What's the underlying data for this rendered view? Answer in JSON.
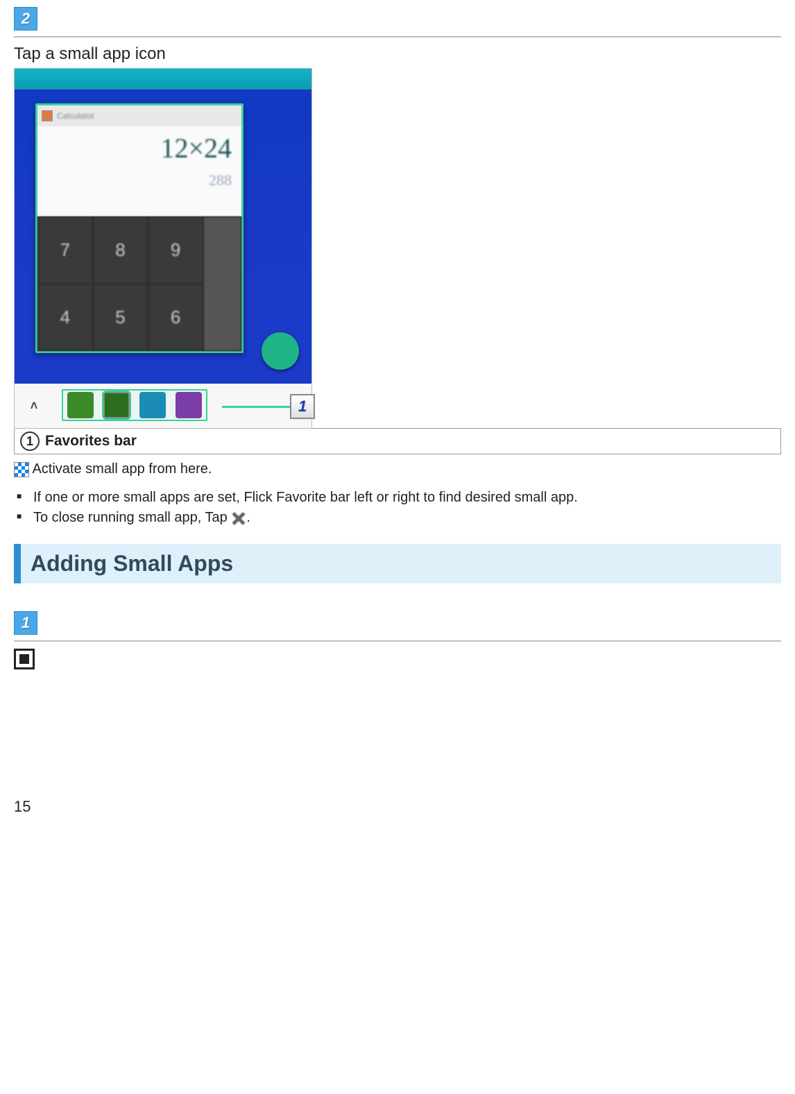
{
  "step2": {
    "number": "2",
    "instruction": "Tap a small app icon",
    "calculator": {
      "title": "Calculator",
      "display_line1": "12×24",
      "display_line2": "288",
      "keys_row1": [
        "7",
        "8",
        "9"
      ],
      "keys_row2": [
        "4",
        "5",
        "6"
      ]
    },
    "callout_number": "1"
  },
  "legend": {
    "num": "1",
    "title": "Favorites bar"
  },
  "activate_text": "Activate small app from here.",
  "bullets": {
    "b1": "If one or more small apps are set, Flick Favorite bar left or right to find desired small app.",
    "b2_before": "To close running small app, Tap ",
    "b2_after": "."
  },
  "section_heading": "Adding Small Apps",
  "step1": {
    "number": "1"
  },
  "page_number": "15"
}
